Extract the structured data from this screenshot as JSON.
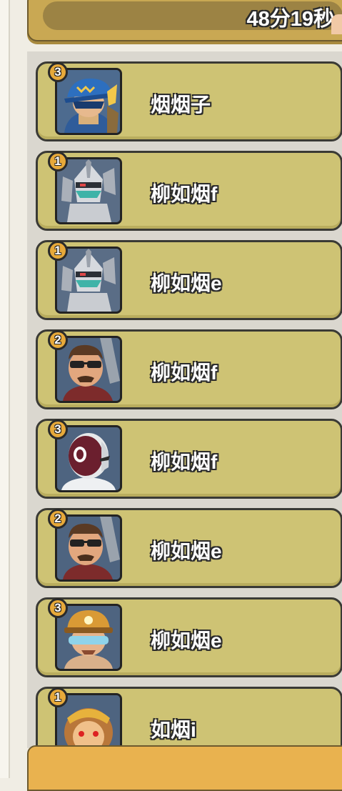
{
  "header": {
    "timer_text": "48分19秒"
  },
  "entries": [
    {
      "rank": "3",
      "name": "烟烟子",
      "avatar_icon": "hero-blue-hat-avatar"
    },
    {
      "rank": "1",
      "name": "柳如烟f",
      "avatar_icon": "robot-silver-avatar"
    },
    {
      "rank": "1",
      "name": "柳如烟e",
      "avatar_icon": "robot-silver-avatar"
    },
    {
      "rank": "2",
      "name": "柳如烟f",
      "avatar_icon": "man-sunglasses-avatar"
    },
    {
      "rank": "3",
      "name": "柳如烟f",
      "avatar_icon": "fencer-mask-avatar"
    },
    {
      "rank": "2",
      "name": "柳如烟e",
      "avatar_icon": "man-sunglasses-avatar"
    },
    {
      "rank": "3",
      "name": "柳如烟e",
      "avatar_icon": "miner-helmet-avatar"
    },
    {
      "rank": "1",
      "name": "如烟i",
      "avatar_icon": "monkey-king-avatar"
    }
  ],
  "colors": {
    "row_bg": "#cec374",
    "row_border": "#3a3a35",
    "rank_badge": "#e7a93a",
    "banner": "#c9a853",
    "bottom_bar": "#e9b24f"
  }
}
